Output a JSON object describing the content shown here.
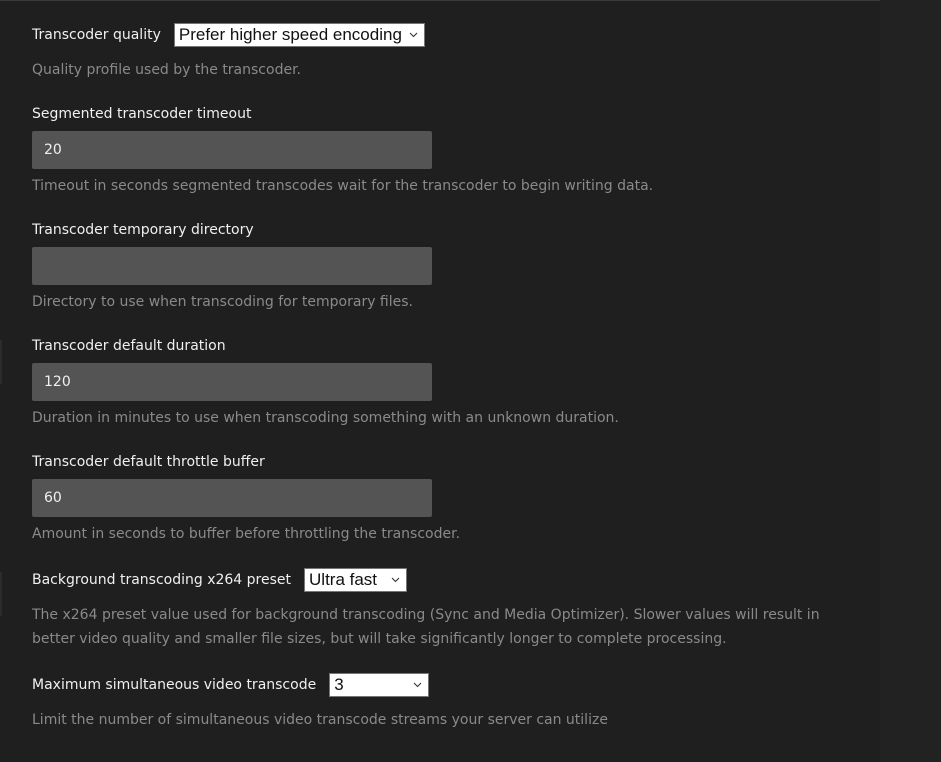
{
  "settings": {
    "transcoder_quality": {
      "label": "Transcoder quality",
      "value": "Prefer higher speed encoding",
      "help": "Quality profile used by the transcoder."
    },
    "segmented_timeout": {
      "label": "Segmented transcoder timeout",
      "value": "20",
      "help": "Timeout in seconds segmented transcodes wait for the transcoder to begin writing data."
    },
    "temp_directory": {
      "label": "Transcoder temporary directory",
      "value": "",
      "help": "Directory to use when transcoding for temporary files."
    },
    "default_duration": {
      "label": "Transcoder default duration",
      "value": "120",
      "help": "Duration in minutes to use when transcoding something with an unknown duration."
    },
    "throttle_buffer": {
      "label": "Transcoder default throttle buffer",
      "value": "60",
      "help": "Amount in seconds to buffer before throttling the transcoder."
    },
    "x264_preset": {
      "label": "Background transcoding x264 preset",
      "value": "Ultra fast",
      "help": "The x264 preset value used for background transcoding (Sync and Media Optimizer). Slower values will result in better video quality and smaller file sizes, but will take significantly longer to complete processing."
    },
    "max_simultaneous": {
      "label": "Maximum simultaneous video transcode",
      "value": "3",
      "help": "Limit the number of simultaneous video transcode streams your server can utilize"
    }
  },
  "icons": {
    "select_arrow": "chevron-down-icon"
  },
  "colors": {
    "background": "#1f1f1f",
    "input_background": "#545454",
    "help_text": "#8a8a8a",
    "label_text": "#f0f0f0"
  }
}
